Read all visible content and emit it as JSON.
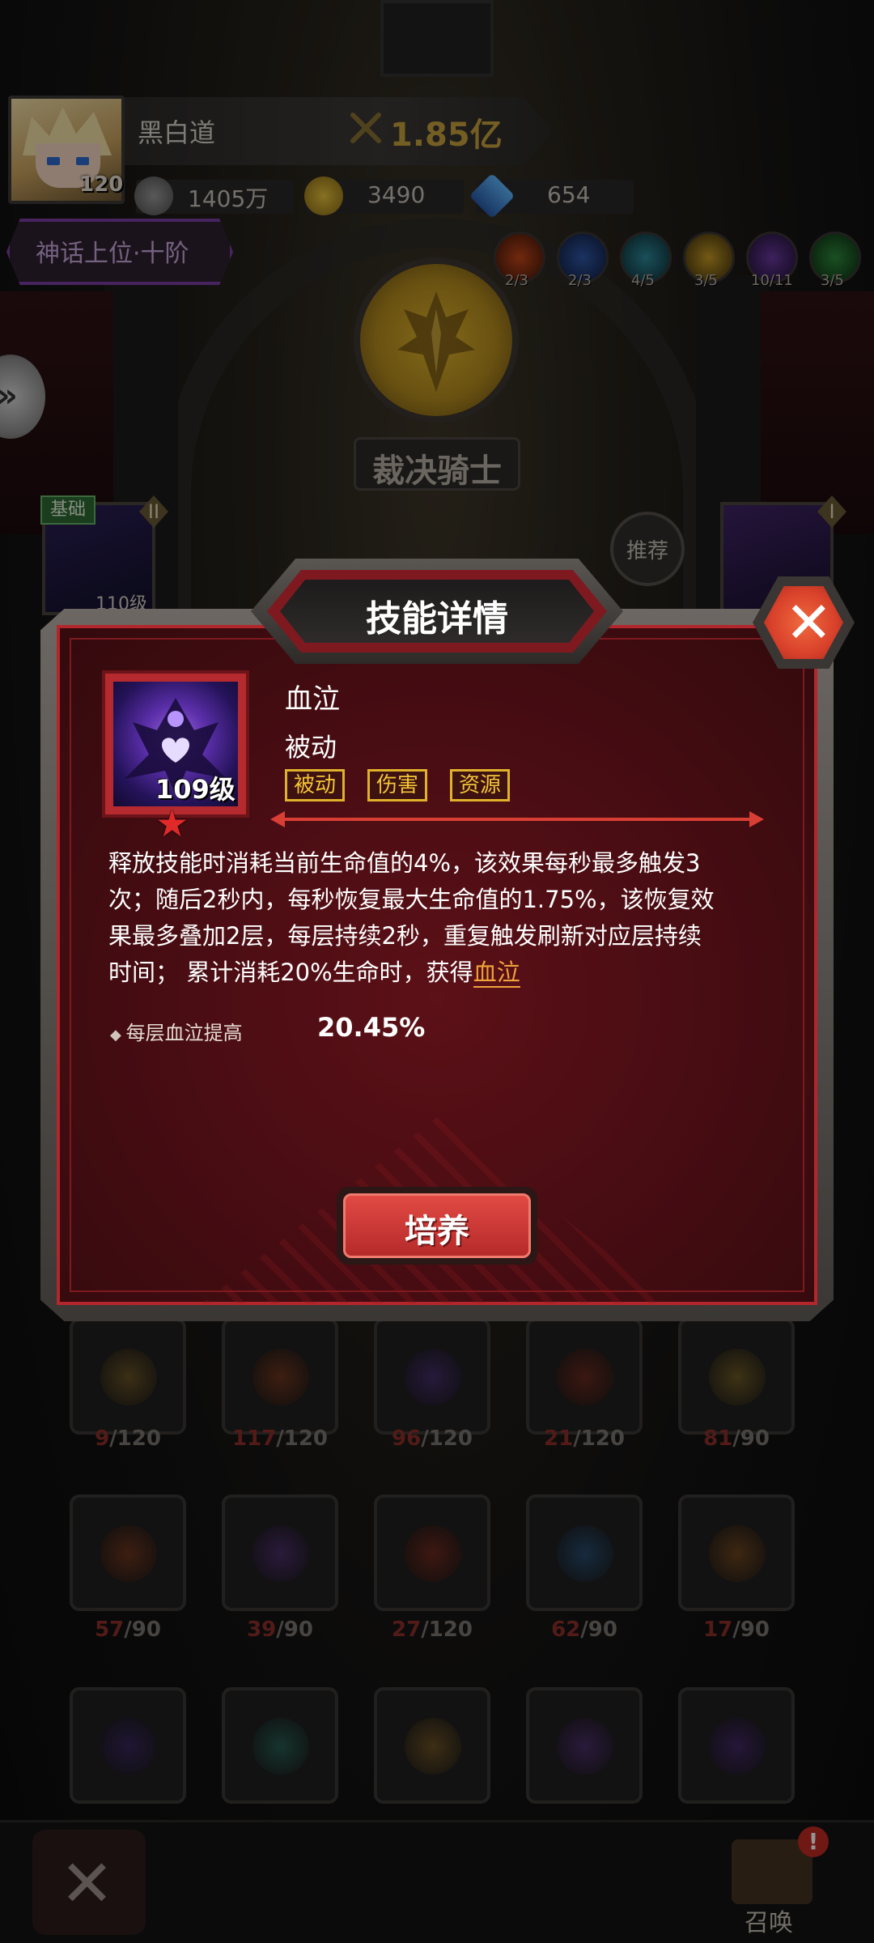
{
  "header": {
    "player_name": "黑白道",
    "player_level": "120",
    "combat_power": "1.85亿",
    "resources": [
      {
        "icon": "coin-icon",
        "value": "1405万"
      },
      {
        "icon": "gold-coin-icon",
        "value": "3490"
      },
      {
        "icon": "gem-icon",
        "value": "654"
      }
    ],
    "tier": "神话上位·十阶"
  },
  "elements": [
    {
      "icon": "fire-element-icon",
      "count": "2/3",
      "color": "#c4471a"
    },
    {
      "icon": "water-element-icon",
      "count": "2/3",
      "color": "#2f58a8"
    },
    {
      "icon": "ice-element-icon",
      "count": "4/5",
      "color": "#2e8a9c"
    },
    {
      "icon": "light-element-icon",
      "count": "3/5",
      "color": "#c89c26"
    },
    {
      "icon": "dark-element-icon",
      "count": "10/11",
      "color": "#6a3aa0"
    },
    {
      "icon": "wind-element-icon",
      "count": "3/5",
      "color": "#2e8a3c"
    }
  ],
  "hero": {
    "name": "裁决骑士",
    "recommend_label": "推荐",
    "left_card": {
      "tag": "基础",
      "roman": "II",
      "level": "110级"
    },
    "right_card": {
      "roman": "I"
    }
  },
  "modal": {
    "title": "技能详情",
    "skill": {
      "name": "血泣",
      "type": "被动",
      "level": "109级",
      "tags": [
        "被动",
        "伤害",
        "资源"
      ]
    },
    "description_line1": "释放技能时消耗当前生命值的4%，该效果每秒最多触发3",
    "description_line2": "次；随后2秒内，每秒恢复最大生命值的1.75%，该恢复效",
    "description_line3": "果最多叠加2层，每层持续2秒，重复触发刷新对应层持续",
    "description_line4_prefix": "时间；  累计消耗20%生命时，获得",
    "description_link": "血泣",
    "stat": {
      "label": "每层血泣提高",
      "value": "20.45%"
    },
    "train_button": "培养"
  },
  "grid": [
    {
      "cur": "9",
      "max": "/120",
      "color": "#a07a2a"
    },
    {
      "cur": "117",
      "max": "/120",
      "color": "#a8461e"
    },
    {
      "cur": "96",
      "max": "/120",
      "color": "#5e3aa2"
    },
    {
      "cur": "21",
      "max": "/120",
      "color": "#a2321e"
    },
    {
      "cur": "81",
      "max": "/90",
      "color": "#a8862a"
    },
    {
      "cur": "57",
      "max": "/90",
      "color": "#a8461e"
    },
    {
      "cur": "39",
      "max": "/90",
      "color": "#6a3aa0"
    },
    {
      "cur": "27",
      "max": "/120",
      "color": "#a8321e"
    },
    {
      "cur": "62",
      "max": "/90",
      "color": "#2e6ea8"
    },
    {
      "cur": "17",
      "max": "/90",
      "color": "#a8621e"
    },
    {
      "cur": "",
      "max": "",
      "color": "#4a2e8a"
    },
    {
      "cur": "",
      "max": "",
      "color": "#2e8a7a"
    },
    {
      "cur": "",
      "max": "",
      "color": "#a87a2a"
    },
    {
      "cur": "",
      "max": "",
      "color": "#6a3aa0"
    },
    {
      "cur": "",
      "max": "",
      "color": "#5a2e9a"
    }
  ],
  "bottom": {
    "summon_label": "召唤",
    "alert": "!"
  }
}
